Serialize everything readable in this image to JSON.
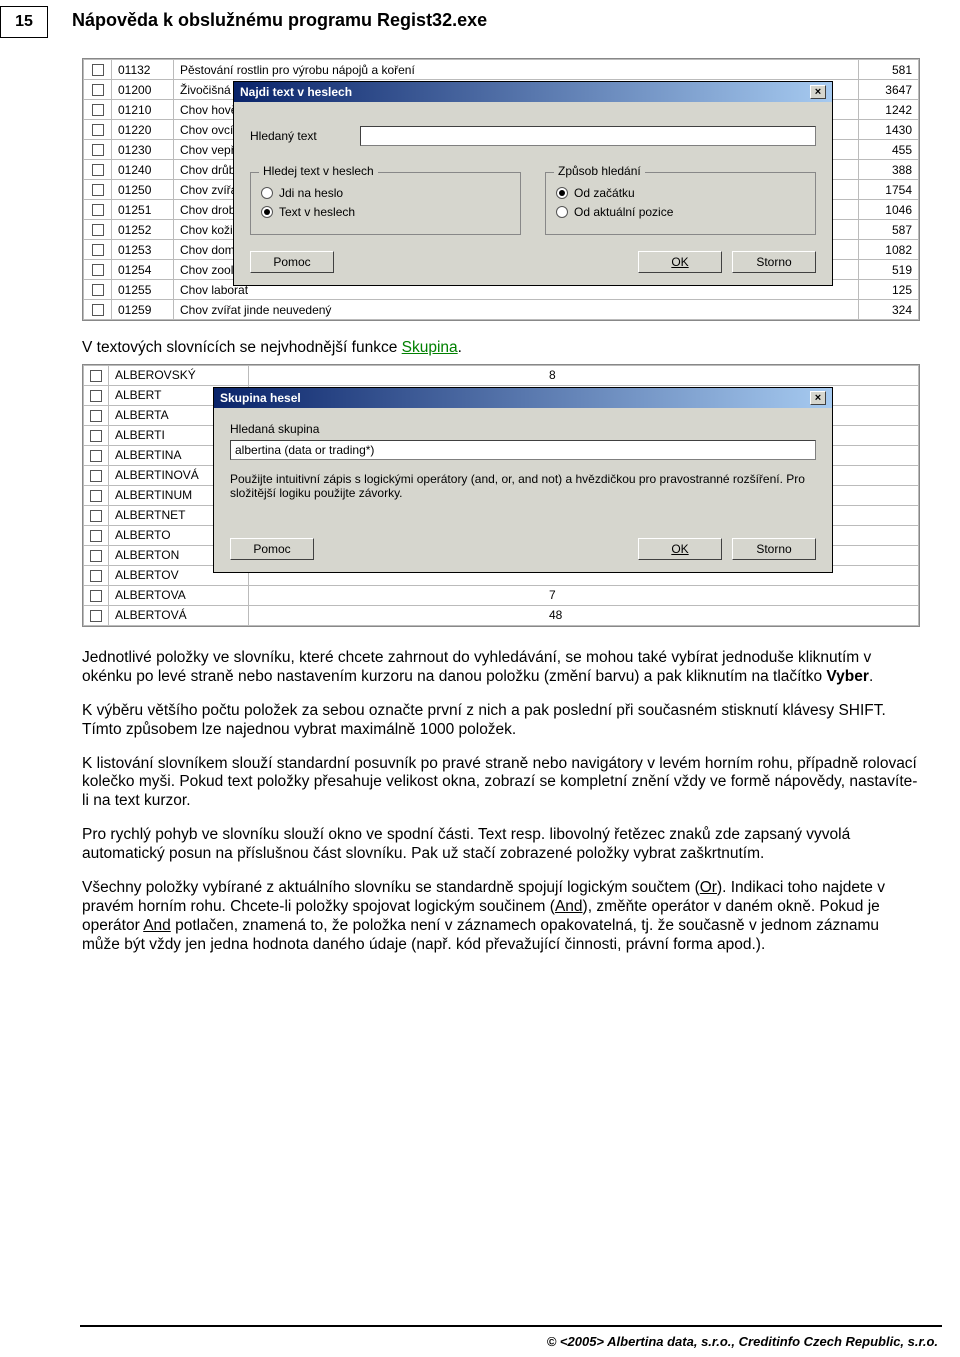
{
  "header": {
    "page_number": "15",
    "title": "Nápověda k obslužnému programu Regist32.exe"
  },
  "table_top": {
    "rows": [
      {
        "code": "01132",
        "desc": "Pěstování rostlin pro výrobu nápojů a koření",
        "val": "581"
      },
      {
        "code": "01200",
        "desc": "Živočišná vý",
        "val": "3647"
      },
      {
        "code": "01210",
        "desc": "Chov hovězí",
        "val": "1242"
      },
      {
        "code": "01220",
        "desc": "Chov ovcí, k",
        "val": "1430"
      },
      {
        "code": "01230",
        "desc": "Chov vepřov",
        "val": "455"
      },
      {
        "code": "01240",
        "desc": "Chov drůbež",
        "val": "388"
      },
      {
        "code": "01250",
        "desc": "Chov zvířat",
        "val": "1754"
      },
      {
        "code": "01251",
        "desc": "Chov drobný",
        "val": "1046"
      },
      {
        "code": "01252",
        "desc": "Chov kožišin",
        "val": "587"
      },
      {
        "code": "01253",
        "desc": "Chov domác",
        "val": "1082"
      },
      {
        "code": "01254",
        "desc": "Chov zoolog",
        "val": "519"
      },
      {
        "code": "01255",
        "desc": "Chov laborat",
        "val": "125"
      },
      {
        "code": "01259",
        "desc": "Chov zvířat jinde neuvedený",
        "val": "324"
      }
    ]
  },
  "dialog1": {
    "title": "Najdi text v heslech",
    "search_label": "Hledaný text",
    "group1_title": "Hledej text v heslech",
    "group1_opt1": "Jdi na heslo",
    "group1_opt2": "Text v heslech",
    "group2_title": "Způsob hledání",
    "group2_opt1": "Od začátku",
    "group2_opt2": "Od aktuální pozice",
    "btn_help": "Pomoc",
    "btn_ok": "OK",
    "btn_cancel": "Storno"
  },
  "mid_text": {
    "line": "V textových slovnících se nejvhodnější funkce ",
    "link": "Skupina",
    "dot": "."
  },
  "list2": {
    "left": [
      "ALBEROVSKÝ",
      "ALBERT",
      "ALBERTA",
      "ALBERTI",
      "ALBERTINA",
      "ALBERTINOVÁ",
      "ALBERTINUM",
      "ALBERTNET",
      "ALBERTO",
      "ALBERTON",
      "ALBERTOV",
      "ALBERTOVA",
      "ALBERTOVÁ"
    ],
    "right_0": "8",
    "right_11": "7",
    "right_12": "48"
  },
  "dialog2": {
    "title": "Skupina hesel",
    "label": "Hledaná skupina",
    "input_value": "albertina (data or trading*)",
    "hint": "Použijte intuitivní zápis s logickými operátory (and, or, and not) a hvězdičkou pro pravostranné rozšíření. Pro složitější logiku použijte závorky.",
    "btn_help": "Pomoc",
    "btn_ok": "OK",
    "btn_cancel": "Storno"
  },
  "body_text": {
    "p1a": "Jednotlivé položky ve slovníku, které chcete zahrnout do vyhledávání, se mohou také vybírat jednoduše kliknutím v okénku po levé straně nebo nastavením kurzoru na danou položku (změní barvu) a pak kliknutím na tlačítko ",
    "p1b": "Vyber",
    "p1c": ".",
    "p2": "K výběru většího počtu položek za sebou označte první z nich a pak poslední při současném stisknutí klávesy SHIFT. Tímto způsobem lze najednou vybrat maximálně 1000 položek.",
    "p3": "K listování slovníkem slouží standardní posuvník po pravé straně nebo navigátory v levém horním rohu, případně rolovací kolečko myši. Pokud text položky přesahuje velikost okna, zobrazí se kompletní znění vždy ve formě nápovědy, nastavíte-li na text kurzor.",
    "p4": "Pro rychlý pohyb ve slovníku slouží okno ve spodní části. Text resp. libovolný řetězec znaků zde zapsaný vyvolá automatický posun na příslušnou část slovníku. Pak už stačí zobrazené položky vybrat zaškrtnutím.",
    "p5a": "Všechny položky vybírané z aktuálního slovníku se standardně spojují logickým součtem (",
    "p5or": "Or",
    "p5b": "). Indikaci toho najdete v pravém horním rohu. Chcete-li položky spojovat logickým součinem (",
    "p5and": "And",
    "p5c": "), změňte operátor v daném okně. Pokud je operátor ",
    "p5and2": "And",
    "p5d": " potlačen, znamená to, že položka není v záznamech opakovatelná, tj. že současně v jednom záznamu může být vždy jen jedna hodnota daného údaje (např. kód převažující činnosti, právní forma apod.)."
  },
  "footer": "© <2005> Albertina data, s.r.o., Creditinfo Czech Republic, s.r.o."
}
